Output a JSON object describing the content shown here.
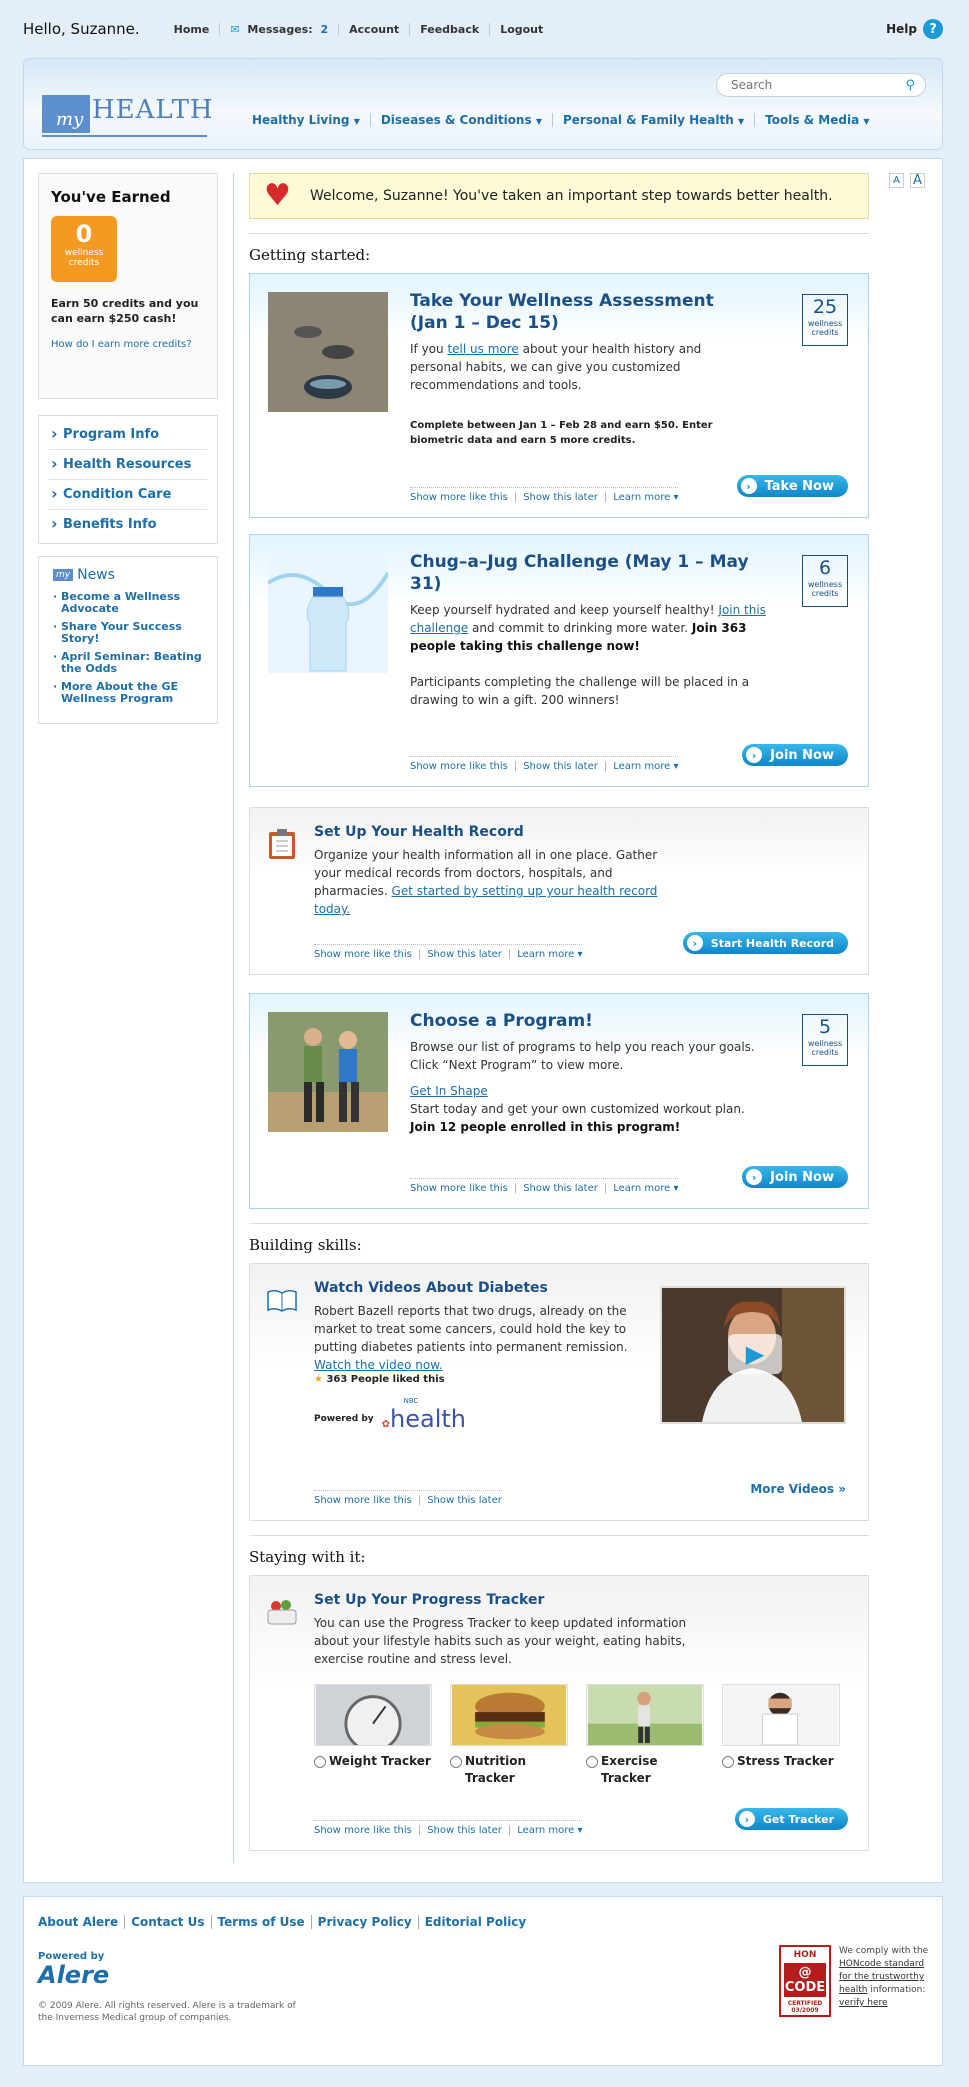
{
  "topbar": {
    "greeting": "Hello, Suzanne.",
    "links": [
      "Home",
      "Messages:",
      "Account",
      "Feedback",
      "Logout"
    ],
    "messages_count": "2",
    "help": "Help"
  },
  "header": {
    "logo_my": "my",
    "logo_health": "HEALTH",
    "search_placeholder": "Search",
    "nav": [
      "Healthy Living",
      "Diseases & Conditions",
      "Personal & Family Health",
      "Tools & Media"
    ]
  },
  "sidebar": {
    "earned_title": "You've Earned",
    "credits": "0",
    "credits_label": "wellness credits",
    "earn_msg": "Earn 50 credits and you can earn $250 cash!",
    "how_link": "How do I earn more credits?",
    "menu": [
      "Program Info",
      "Health Resources",
      "Condition Care",
      "Benefits Info"
    ],
    "news_title": "News",
    "news_my": "my",
    "news": [
      "Become a Wellness Advocate",
      "Share Your Success Story!",
      "April Seminar: Beating the Odds",
      "More About the GE Wellness Program"
    ]
  },
  "font_sizes": [
    "A",
    "A"
  ],
  "welcome": "Welcome, Suzanne! You've taken an important step towards better health.",
  "sections": {
    "s1": "Getting started:",
    "s2": "Building skills:",
    "s3": "Staying with it:"
  },
  "actions": {
    "more": "Show more like this",
    "later": "Show this later",
    "learn": "Learn more"
  },
  "cards": {
    "assessment": {
      "title": "Take Your Wellness Assessment (Jan 1 – Dec 15)",
      "p1a": "If you ",
      "p1link": "tell us more",
      "p1b": " about your health history and personal habits, we can give you customized recommendations and tools.",
      "note": "Complete between Jan 1 – Feb 28 and earn $50. Enter biometric data and earn 5 more credits.",
      "credits": "25",
      "credits_label": "wellness credits",
      "button": "Take Now"
    },
    "challenge": {
      "title": "Chug–a–Jug Challenge (May 1 – May 31)",
      "p1a": "Keep yourself hydrated and keep yourself healthy! ",
      "p1link": "Join this challenge",
      "p1b": " and commit to drinking more water. ",
      "p1bold": "Join 363 people taking this challenge now!",
      "p2": "Participants completing the challenge will be placed in a drawing to win a gift. 200 winners!",
      "credits": "6",
      "credits_label": "wellness credits",
      "button": "Join Now"
    },
    "record": {
      "title": "Set Up Your Health Record",
      "p1": "Organize your health information all in one place. Gather your medical records from doctors, hospitals, and pharmacies. ",
      "p1link": "Get started by setting up your health record today.",
      "button": "Start Health Record"
    },
    "program": {
      "title": "Choose a Program!",
      "p1": "Browse our list of programs to help you reach your goals. Click “Next Program” to view more.",
      "link": "Get In Shape",
      "p2": "Start today and get your own customized workout plan.",
      "p2bold": "Join 12 people enrolled in this program!",
      "credits": "5",
      "credits_label": "wellness credits",
      "button": "Join Now"
    },
    "videos": {
      "title": "Watch Videos About Diabetes",
      "p1": "Robert Bazell reports that two drugs, already on the market to treat some cancers, could hold the key to putting diabetes patients into permanent remission.",
      "link": "Watch the video now.",
      "liked": "363 People liked this",
      "powered": "Powered by",
      "brand": "health",
      "brand_small": "NBC",
      "more_videos": "More Videos »"
    },
    "tracker": {
      "title": "Set Up Your Progress Tracker",
      "p1": "You can use the Progress Tracker to keep updated information about your lifestyle habits such as your weight, eating habits, exercise routine and stress level.",
      "items": [
        "Weight Tracker",
        "Nutrition Tracker",
        "Exercise Tracker",
        "Stress Tracker"
      ],
      "button": "Get Tracker"
    }
  },
  "footer": {
    "links": [
      "About Alere",
      "Contact Us",
      "Terms of Use",
      "Privacy Policy",
      "Editorial Policy"
    ],
    "powered": "Powered by",
    "brand": "Alere",
    "copyright": "© 2009 Alere. All rights reserved. Alere is a trademark of the Inverness Medical group of companies.",
    "hon_top": "HON",
    "hon_mid": "@",
    "hon_code": "CODE",
    "hon_cert": "CERTIFIED 03/2009",
    "hon_text_a": "We comply with the ",
    "hon_link1": "HONcode standard for the trustworthy health",
    "hon_text_b": " information: ",
    "hon_link2": "verify here"
  },
  "colors": {
    "accent": "#1d6fa8",
    "button": "#1192cf",
    "badge": "#f39a22",
    "title": "#1b4f87"
  }
}
